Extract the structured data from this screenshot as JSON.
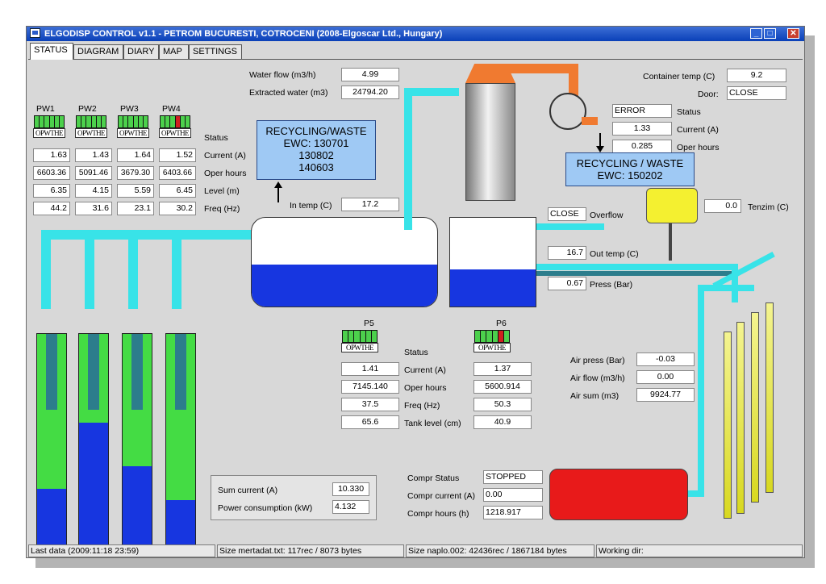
{
  "window": {
    "title": "ELGODISP CONTROL v1.1 - PETROM BUCURESTI, COTROCENI (2008-Elgoscar Ltd., Hungary)"
  },
  "tabs": [
    "STATUS",
    "DIAGRAM",
    "DIARY",
    "MAP",
    "SETTINGS"
  ],
  "pw": {
    "headers": [
      "PW1",
      "PW2",
      "PW3",
      "PW4"
    ],
    "codes": [
      "OPWTHE",
      "OPWTHE",
      "OPWTHE",
      "OPWTHE"
    ],
    "row_labels": [
      "Status",
      "Current (A)",
      "Oper hours",
      "Level (m)",
      "Freq (Hz)"
    ],
    "current": [
      "1.63",
      "1.43",
      "1.64",
      "1.52"
    ],
    "oper_hours": [
      "6603.36",
      "5091.46",
      "3679.30",
      "6403.66"
    ],
    "level": [
      "6.35",
      "4.15",
      "5.59",
      "6.45"
    ],
    "freq": [
      "44.2",
      "31.6",
      "23.1",
      "30.2"
    ],
    "water_fraction": [
      0.3,
      0.6,
      0.4,
      0.25
    ],
    "colors": {
      "well_green": "#44dc44",
      "water_blue": "#1736e0"
    }
  },
  "water": {
    "flow_label": "Water flow (m3/h)",
    "flow_value": "4.99",
    "extracted_label": "Extracted water (m3)",
    "extracted_value": "24794.20"
  },
  "recycling1": {
    "line1": "RECYCLING/WASTE",
    "line2": "EWC: 130701",
    "line3": "130802",
    "line4": "140603"
  },
  "recycling2": {
    "line1": "RECYCLING / WASTE",
    "line2": "EWC: 150202"
  },
  "in_temp": {
    "label": "In temp (C)",
    "value": "17.2"
  },
  "container": {
    "temp_label": "Container temp (C)",
    "temp_value": "9.2",
    "door_label": "Door:",
    "door_value": "CLOSE"
  },
  "blower": {
    "status_value": "ERROR",
    "status_label": "Status",
    "current_value": "1.33",
    "current_label": "Current (A)",
    "hours_value": "0.285",
    "hours_label": "Oper hours"
  },
  "tenzim": {
    "value": "0.0",
    "label": "Tenzim (C)"
  },
  "overflow": {
    "value": "CLOSE",
    "label": "Overflow"
  },
  "out_temp": {
    "value": "16.7",
    "label": "Out temp (C)"
  },
  "press": {
    "value": "0.67",
    "label": "Press (Bar)"
  },
  "pumps": {
    "p5": {
      "name": "P5",
      "code": "OPWTHE",
      "current": "1.41",
      "hours": "7145.140",
      "freq": "37.5",
      "tank": "65.6"
    },
    "p6": {
      "name": "P6",
      "code": "OPWTHE",
      "current": "1.37",
      "hours": "5600.914",
      "freq": "50.3",
      "tank": "40.9"
    },
    "labels": [
      "Status",
      "Current (A)",
      "Oper hours",
      "Freq (Hz)",
      "Tank level (cm)"
    ]
  },
  "air": {
    "press_label": "Air press (Bar)",
    "press_value": "-0.03",
    "flow_label": "Air flow (m3/h)",
    "flow_value": "0.00",
    "sum_label": "Air sum (m3)",
    "sum_value": "9924.77"
  },
  "power": {
    "sum_label": "Sum current (A)",
    "sum_value": "10.330",
    "cons_label": "Power consumption (kW)",
    "cons_value": "4.132"
  },
  "compressor": {
    "status_label": "Compr Status",
    "status_value": "STOPPED",
    "current_label": "Compr current (A)",
    "current_value": "0.00",
    "hours_label": "Compr hours (h)",
    "hours_value": "1218.917",
    "color": "#e81a1a"
  },
  "statusbar": {
    "last_data": "Last data (2009:11:18 23:59)",
    "mertadat": "Size mertadat.txt: 117rec / 8073 bytes",
    "naplo": "Size naplo.002: 42436rec / 1867184 bytes",
    "workdir": "Working dir:"
  }
}
